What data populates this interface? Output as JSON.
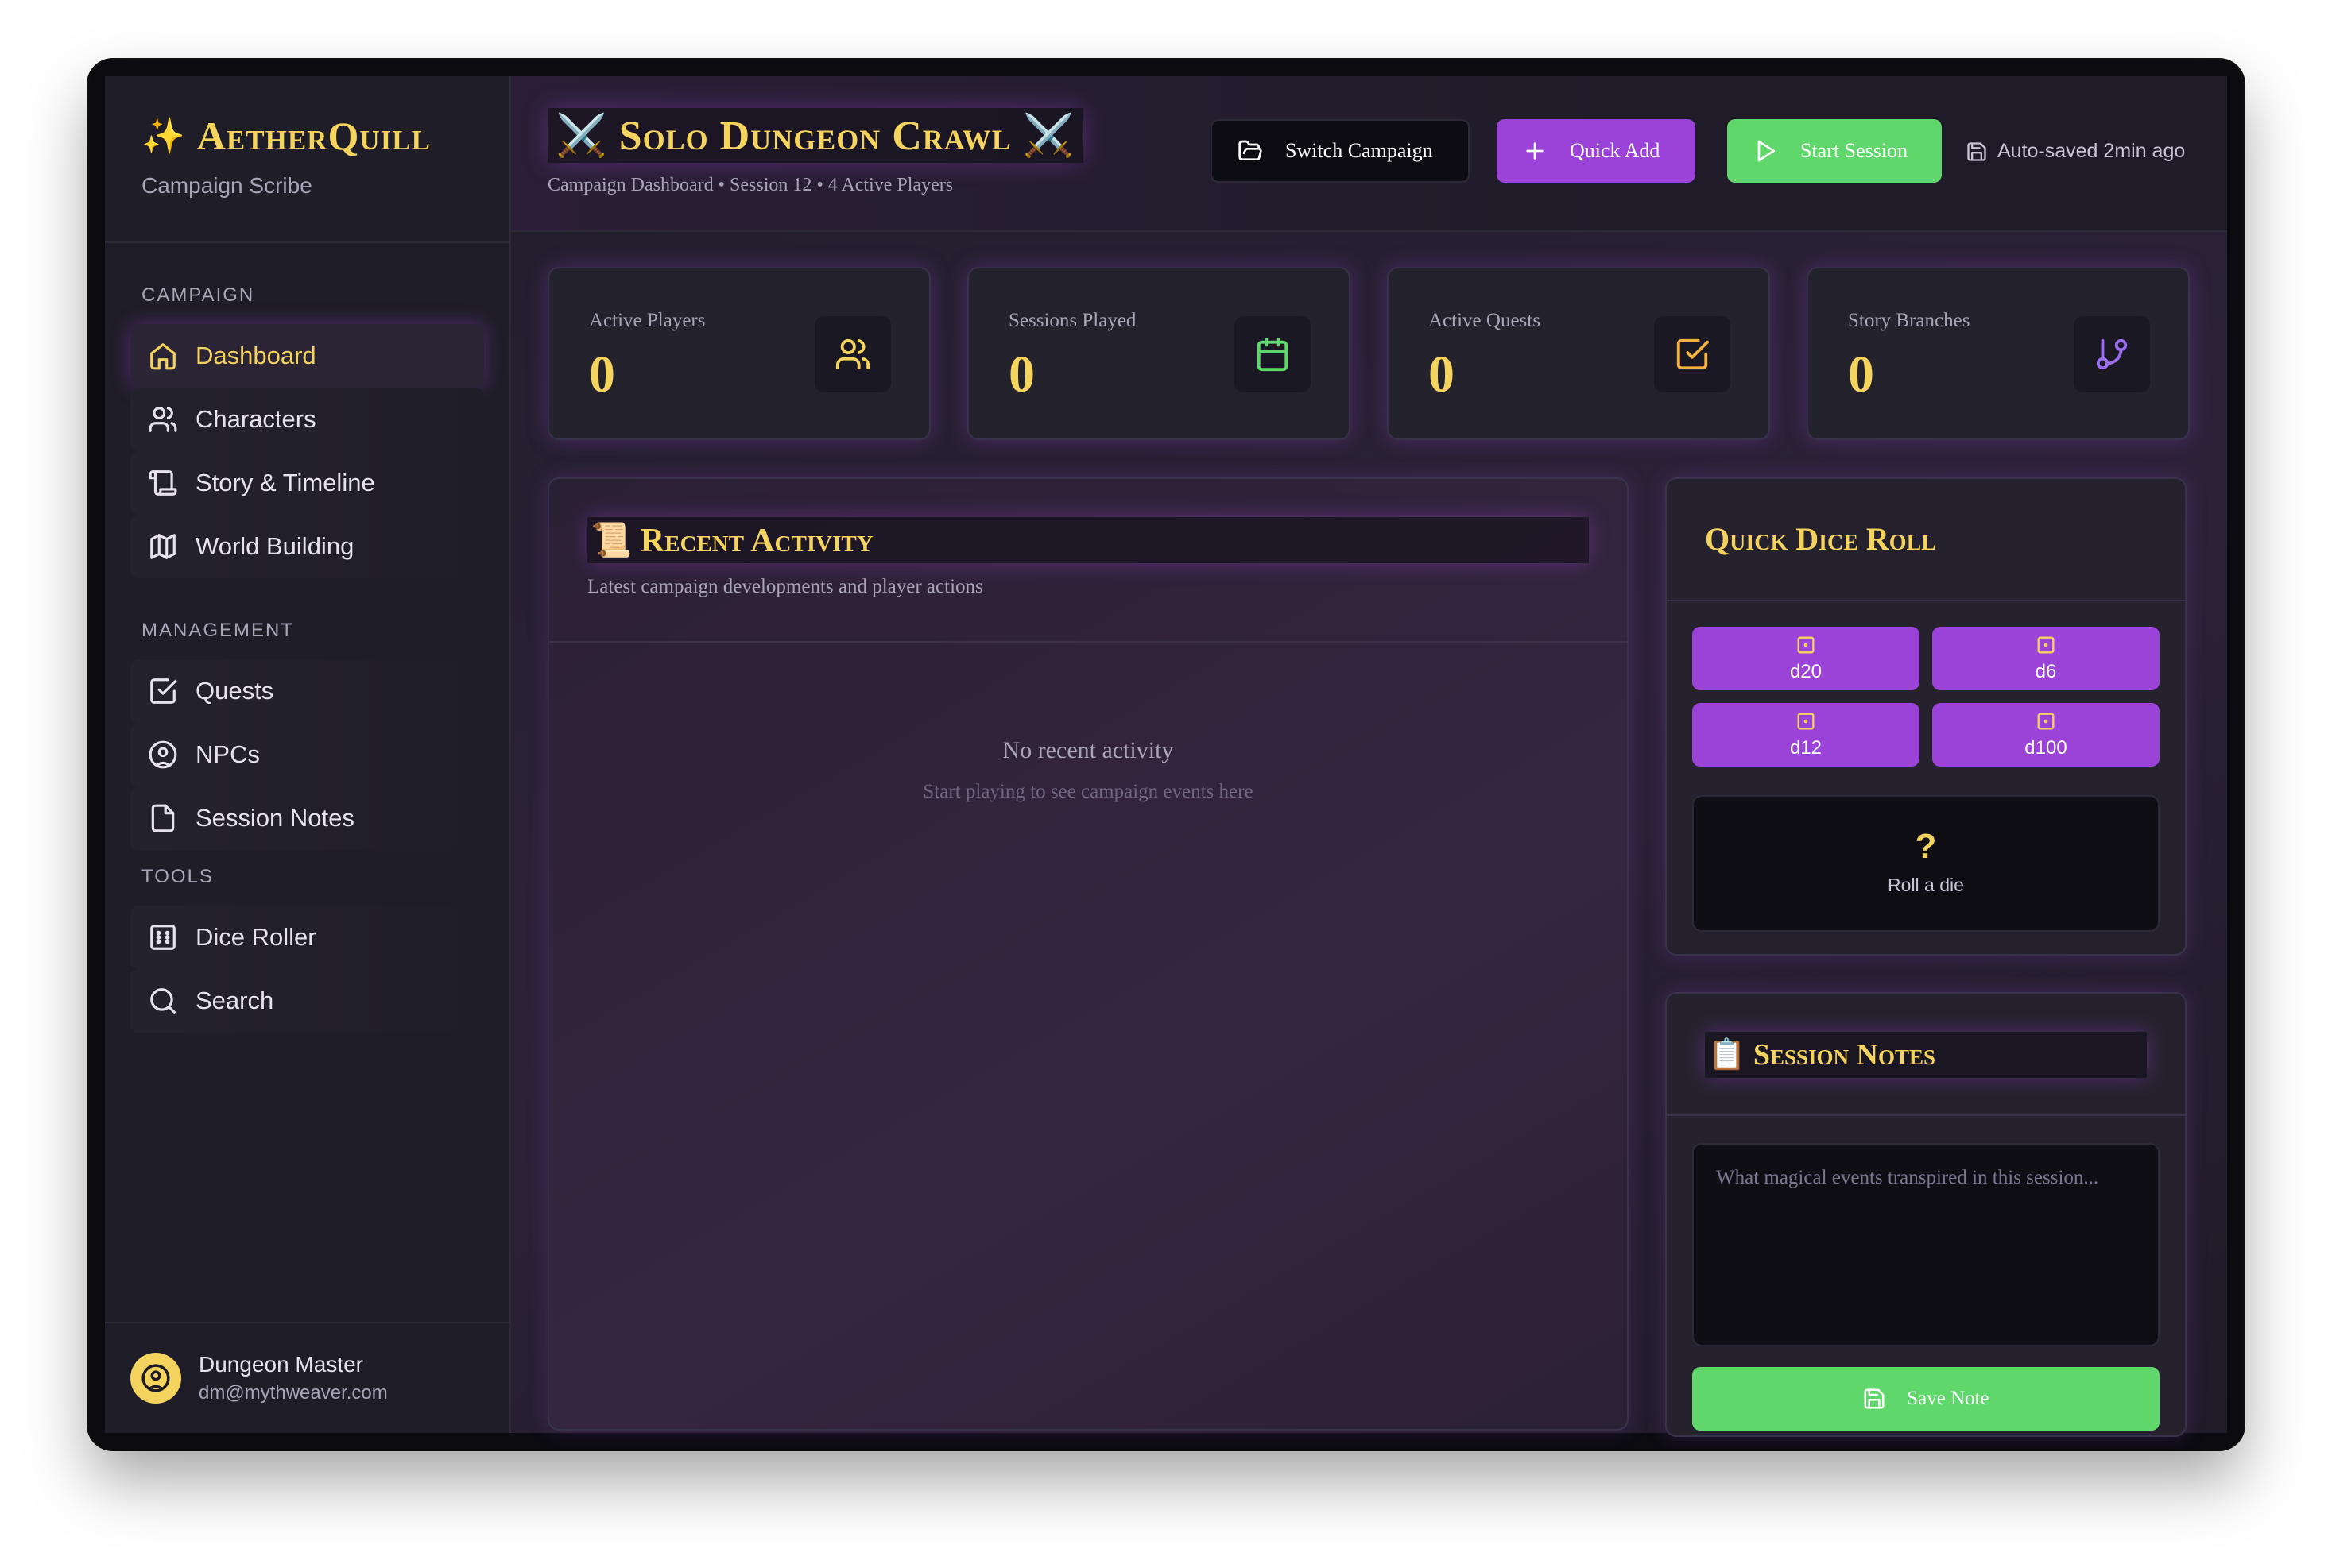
{
  "brand": {
    "title": "AetherQuill",
    "subtitle": "Campaign Scribe",
    "icon": "sparkles-icon"
  },
  "sidebar": {
    "campaign_label": "CAMPAIGN",
    "campaign_items": [
      {
        "label": "Dashboard",
        "icon": "home-icon",
        "active": true
      },
      {
        "label": "Characters",
        "icon": "users-icon"
      },
      {
        "label": "Story & Timeline",
        "icon": "scroll-icon"
      },
      {
        "label": "World Building",
        "icon": "map-icon"
      }
    ],
    "management_label": "MANAGEMENT",
    "management_items": [
      {
        "label": "Quests",
        "icon": "checkbox-icon"
      },
      {
        "label": "NPCs",
        "icon": "user-circle-icon"
      },
      {
        "label": "Session Notes",
        "icon": "file-icon"
      }
    ],
    "tools_label": "TOOLS",
    "tools_items": [
      {
        "label": "Dice Roller",
        "icon": "dice-icon"
      },
      {
        "label": "Search",
        "icon": "search-icon"
      }
    ]
  },
  "user": {
    "name": "Dungeon Master",
    "email": "dm@mythweaver.com"
  },
  "header": {
    "title": "⚔️ Solo Dungeon Crawl ⚔️",
    "subtitle": "Campaign Dashboard • Session 12 • 4 Active Players",
    "switch_label": "Switch Campaign",
    "quick_add_label": "Quick Add",
    "start_label": "Start Session",
    "autosave": "Auto-saved 2min ago"
  },
  "stats": [
    {
      "label": "Active Players",
      "value": "0",
      "icon": "users-icon",
      "color": "#f4d35e"
    },
    {
      "label": "Sessions Played",
      "value": "0",
      "icon": "calendar-icon",
      "color": "#5fd76b"
    },
    {
      "label": "Active Quests",
      "value": "0",
      "icon": "check-square-icon",
      "color": "#f4b13e"
    },
    {
      "label": "Story Branches",
      "value": "0",
      "icon": "git-branch-icon",
      "color": "#9b6ef0"
    }
  ],
  "activity": {
    "title": "📜 Recent Activity",
    "subtitle": "Latest campaign developments and player actions",
    "empty_title": "No recent activity",
    "empty_sub": "Start playing to see campaign events here"
  },
  "dice": {
    "title": "Quick Dice Roll",
    "buttons": [
      "d20",
      "d6",
      "d12",
      "d100"
    ],
    "result": "?",
    "result_label": "Roll a die"
  },
  "notes": {
    "title": "📋 Session Notes",
    "placeholder": "What magical events transpired in this session...",
    "value": "",
    "save_label": "Save Note"
  },
  "colors": {
    "accent": "#9b42d8",
    "gold": "#f4d35e",
    "success": "#5fd76b",
    "bg": "#1c1a24"
  }
}
